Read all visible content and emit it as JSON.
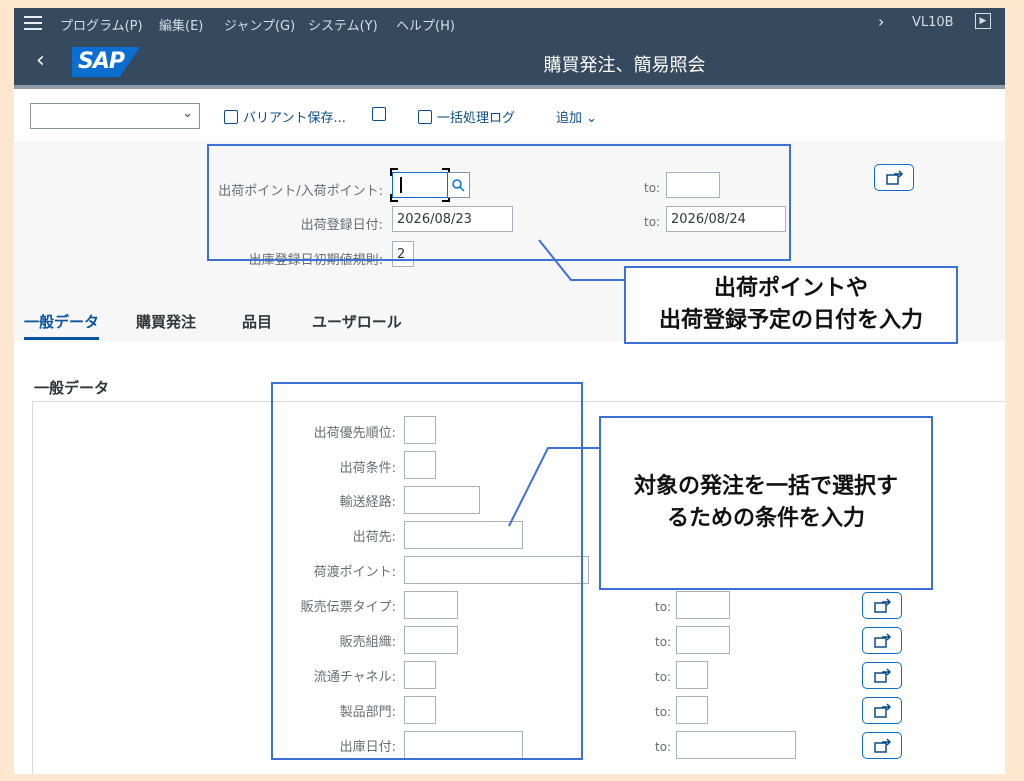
{
  "menu": {
    "items": [
      "プログラム(P)",
      "編集(E)",
      "ジャンプ(G)",
      "システム(Y)",
      "ヘルプ(H)"
    ],
    "tcode": "VL10B"
  },
  "shell": {
    "logo": "SAP",
    "title": "購買発注、簡易照会"
  },
  "toolbar": {
    "variant_save": "バリアント保存...",
    "batch_log": "一括処理ログ",
    "more": "追加"
  },
  "selection": {
    "shipping_point_label": "出荷ポイント/入荷ポイント:",
    "shipping_point_value": "",
    "shipping_point_to": "",
    "delivery_date_label": "出荷登録日付:",
    "delivery_date_from": "2026/08/23",
    "delivery_date_to": "2026/08/24",
    "default_rule_label": "出庫登録日初期値規則:",
    "default_rule_value": "2",
    "to_label": "to:"
  },
  "tabs": [
    "一般データ",
    "購買発注",
    "品目",
    "ユーザロール"
  ],
  "general": {
    "title": "一般データ",
    "fields": [
      {
        "label": "出荷優先順位:",
        "value": ""
      },
      {
        "label": "出荷条件:",
        "value": ""
      },
      {
        "label": "輸送経路:",
        "value": ""
      },
      {
        "label": "出荷先:",
        "value": ""
      },
      {
        "label": "荷渡ポイント:",
        "value": ""
      },
      {
        "label": "販売伝票タイプ:",
        "value": ""
      },
      {
        "label": "販売組織:",
        "value": ""
      },
      {
        "label": "流通チャネル:",
        "value": ""
      },
      {
        "label": "製品部門:",
        "value": ""
      },
      {
        "label": "出庫日付:",
        "value": ""
      }
    ]
  },
  "annotations": {
    "callout1": "出荷ポイントや出荷登録予定の日付を入力",
    "callout1_line1": "出荷ポイントや",
    "callout1_line2": "出荷登録予定の日付を入力",
    "callout2_line1": "対象の発注を一括で選択す",
    "callout2_line2": "るための条件を入力",
    "accent": "#3d6fd8"
  }
}
